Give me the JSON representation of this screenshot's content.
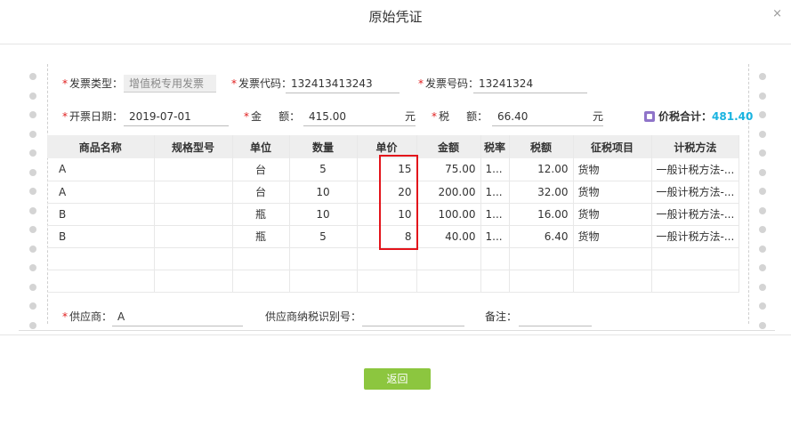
{
  "dialog": {
    "title": "原始凭证",
    "close": "×",
    "return_label": "返回"
  },
  "invoice": {
    "type_label": "发票类型：",
    "type_value": "增值税专用发票",
    "code_label": "发票代码：",
    "code_value": "132413413243",
    "number_label": "发票号码：",
    "number_value": "13241324",
    "date_label": "开票日期：",
    "date_value": "2019-07-01",
    "amount_label": "金     额：",
    "amount_value": "415.00",
    "amount_unit": "元",
    "tax_label": "税     额：",
    "tax_value": "66.40",
    "tax_unit": "元",
    "total_label": "价税合计：",
    "total_value": "481.40"
  },
  "table": {
    "headers": [
      "商品名称",
      "规格型号",
      "单位",
      "数量",
      "单价",
      "金额",
      "税率",
      "税额",
      "征税项目",
      "计税方法"
    ],
    "rows": [
      [
        "A",
        "",
        "台",
        "5",
        "15",
        "75.00",
        "1...",
        "12.00",
        "货物",
        "一般计税方法-..."
      ],
      [
        "A",
        "",
        "台",
        "10",
        "20",
        "200.00",
        "1...",
        "32.00",
        "货物",
        "一般计税方法-..."
      ],
      [
        "B",
        "",
        "瓶",
        "10",
        "10",
        "100.00",
        "1...",
        "16.00",
        "货物",
        "一般计税方法-..."
      ],
      [
        "B",
        "",
        "瓶",
        "5",
        "8",
        "40.00",
        "1...",
        "6.40",
        "货物",
        "一般计税方法-..."
      ],
      [
        "",
        "",
        "",
        "",
        "",
        "",
        "",
        "",
        "",
        ""
      ],
      [
        "",
        "",
        "",
        "",
        "",
        "",
        "",
        "",
        "",
        ""
      ]
    ]
  },
  "supplier": {
    "supplier_label": "供应商：",
    "supplier_value": "A",
    "taxid_label": "供应商纳税识别号：",
    "taxid_value": "",
    "remark_label": "备注：",
    "remark_value": ""
  },
  "colors": {
    "accent_green": "#8cc63f",
    "total_blue": "#18b3e0",
    "required_red": "#e02020",
    "highlight_red": "#e3141b"
  }
}
